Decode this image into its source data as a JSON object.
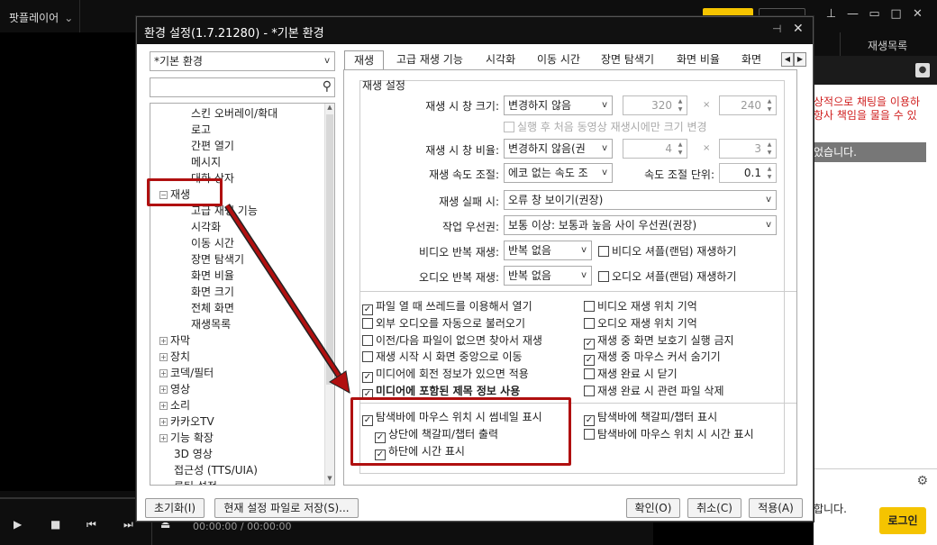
{
  "app": {
    "title": "팟플레이어",
    "title_chevron": "⌄"
  },
  "window_controls": [
    "pin",
    "minimize",
    "restore",
    "maximize",
    "close"
  ],
  "right_panel": {
    "tab_playlist": "재생목록",
    "red_line1": "상적으로 채팅을 이용하",
    "red_line2": "항사 책임을 물을 수 있",
    "grey_text": "었습니다.",
    "notice_text": "합니다.",
    "login_label": "로그인"
  },
  "player": {
    "time_current": "00:00:00",
    "time_sep": "/",
    "time_total": "00:00:00"
  },
  "dialog": {
    "title": "환경 설정(1.7.21280) - *기본 환경",
    "preset_combo": "*기본 환경",
    "tree": {
      "items": [
        {
          "label": "스킨 오버레이/확대"
        },
        {
          "label": "로고"
        },
        {
          "label": "간편 열기"
        },
        {
          "label": "메시지"
        },
        {
          "label": "대화 상자"
        },
        {
          "label": "재생"
        },
        {
          "label": "고급 재생 기능"
        },
        {
          "label": "시각화"
        },
        {
          "label": "이동 시간"
        },
        {
          "label": "장면 탐색기"
        },
        {
          "label": "화면 비율"
        },
        {
          "label": "화면 크기"
        },
        {
          "label": "전체 화면"
        },
        {
          "label": "재생목록"
        },
        {
          "label": "자막"
        },
        {
          "label": "장치"
        },
        {
          "label": "코덱/필터"
        },
        {
          "label": "영상"
        },
        {
          "label": "소리"
        },
        {
          "label": "카카오TV"
        },
        {
          "label": "기능 확장"
        },
        {
          "label": "3D 영상"
        },
        {
          "label": "접근성 (TTS/UIA)"
        },
        {
          "label": "루틴 설정"
        }
      ]
    },
    "tabs": [
      "재생",
      "고급 재생 기능",
      "시각화",
      "이동 시간",
      "장면 탐색기",
      "화면 비율",
      "화면"
    ],
    "group_label": "재생 설정",
    "window_size": {
      "label": "재생 시 창 크기:",
      "value": "변경하지 않음",
      "w": "320",
      "h": "240",
      "x": "×"
    },
    "first_only": "실행 후 처음 동영상 재생시에만 크기 변경",
    "window_ratio": {
      "label": "재생 시 창 비율:",
      "value": "변경하지 않음(권",
      "w": "4",
      "h": "3",
      "x": "×"
    },
    "speed": {
      "label": "재생 속도 조절:",
      "value": "에코 없는 속도 조",
      "unit_label": "속도 조절 단위:",
      "unit_value": "0.1"
    },
    "fail": {
      "label": "재생 실패 시:",
      "value": "오류 창 보이기(권장)"
    },
    "priority": {
      "label": "작업 우선권:",
      "value": "보통 이상: 보통과 높음 사이 우선권(권장)"
    },
    "video_repeat": {
      "label": "비디오 반복 재생:",
      "value": "반복 없음",
      "shuffle": "비디오 셔플(랜덤) 재생하기"
    },
    "audio_repeat": {
      "label": "오디오 반복 재생:",
      "value": "반복 없음",
      "shuffle": "오디오 셔플(랜덤) 재생하기"
    },
    "checks_left": [
      {
        "label": "파일 열 때 쓰레드를 이용해서 열기",
        "checked": true
      },
      {
        "label": "외부 오디오를 자동으로 불러오기",
        "checked": false
      },
      {
        "label": "이전/다음 파일이 없으면 찾아서 재생",
        "checked": false
      },
      {
        "label": "재생 시작 시 화면 중앙으로 이동",
        "checked": false
      },
      {
        "label": "미디어에 회전 정보가 있으면 적용",
        "checked": true
      },
      {
        "label": "미디어에 포함된 제목 정보 사용",
        "checked": true
      }
    ],
    "checks_right": [
      {
        "label": "비디오 재생 위치 기억",
        "checked": false
      },
      {
        "label": "오디오 재생 위치 기억",
        "checked": false
      },
      {
        "label": "재생 중 화면 보호기 실행 금지",
        "checked": true
      },
      {
        "label": "재생 중 마우스 커서 숨기기",
        "checked": true
      },
      {
        "label": "재생 완료 시 닫기",
        "checked": false
      },
      {
        "label": "재생 완료 시 관련 파일 삭제",
        "checked": false
      }
    ],
    "seek_checks": {
      "thumbnail": "탐색바에 마우스 위치 시 썸네일 표시",
      "top_chapter": "상단에 책갈피/챕터 출력",
      "bottom_time": "하단에 시간 표시",
      "chapter": "탐색바에 책갈피/챕터 표시",
      "mouse_time": "탐색바에 마우스 위치 시 시간 표시"
    },
    "buttons": {
      "reset": "초기화(I)",
      "save": "현재 설정 파일로 저장(S)...",
      "ok": "확인(O)",
      "cancel": "취소(C)",
      "apply": "적용(A)"
    }
  },
  "colors": {
    "highlight": "#b01010",
    "accent": "#f5c400"
  }
}
